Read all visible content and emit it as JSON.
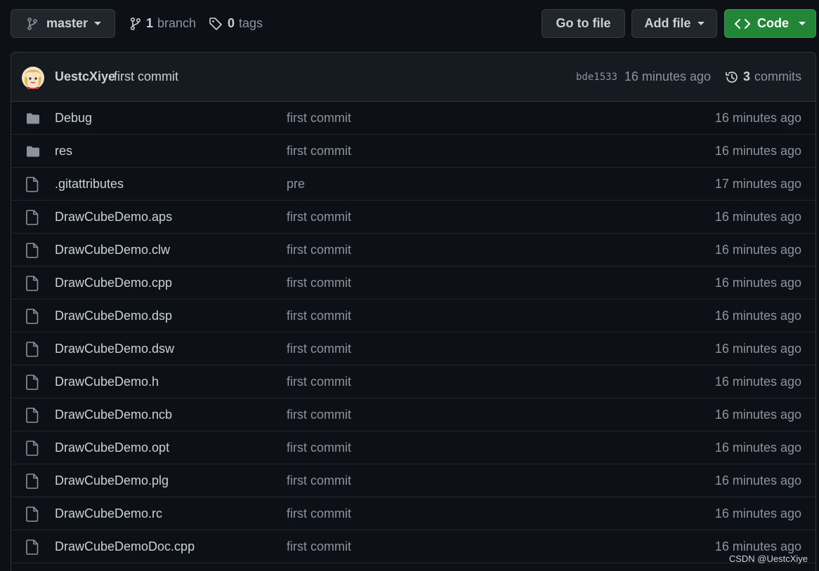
{
  "toolbar": {
    "branch_name": "master",
    "branches_count": "1",
    "branches_label": "branch",
    "tags_count": "0",
    "tags_label": "tags",
    "goto_file_label": "Go to file",
    "add_file_label": "Add file",
    "code_label": "Code"
  },
  "latest_commit": {
    "author": "UestcXiye",
    "message": "first commit",
    "sha": "bde1533",
    "age": "16 minutes ago",
    "commits_count": "3",
    "commits_label": "commits"
  },
  "files": [
    {
      "type": "folder",
      "name": "Debug",
      "commit": "first commit",
      "age": "16 minutes ago"
    },
    {
      "type": "folder",
      "name": "res",
      "commit": "first commit",
      "age": "16 minutes ago"
    },
    {
      "type": "file",
      "name": ".gitattributes",
      "commit": "pre",
      "age": "17 minutes ago"
    },
    {
      "type": "file",
      "name": "DrawCubeDemo.aps",
      "commit": "first commit",
      "age": "16 minutes ago"
    },
    {
      "type": "file",
      "name": "DrawCubeDemo.clw",
      "commit": "first commit",
      "age": "16 minutes ago"
    },
    {
      "type": "file",
      "name": "DrawCubeDemo.cpp",
      "commit": "first commit",
      "age": "16 minutes ago"
    },
    {
      "type": "file",
      "name": "DrawCubeDemo.dsp",
      "commit": "first commit",
      "age": "16 minutes ago"
    },
    {
      "type": "file",
      "name": "DrawCubeDemo.dsw",
      "commit": "first commit",
      "age": "16 minutes ago"
    },
    {
      "type": "file",
      "name": "DrawCubeDemo.h",
      "commit": "first commit",
      "age": "16 minutes ago"
    },
    {
      "type": "file",
      "name": "DrawCubeDemo.ncb",
      "commit": "first commit",
      "age": "16 minutes ago"
    },
    {
      "type": "file",
      "name": "DrawCubeDemo.opt",
      "commit": "first commit",
      "age": "16 minutes ago"
    },
    {
      "type": "file",
      "name": "DrawCubeDemo.plg",
      "commit": "first commit",
      "age": "16 minutes ago"
    },
    {
      "type": "file",
      "name": "DrawCubeDemo.rc",
      "commit": "first commit",
      "age": "16 minutes ago"
    },
    {
      "type": "file",
      "name": "DrawCubeDemoDoc.cpp",
      "commit": "first commit",
      "age": "16 minutes ago"
    }
  ],
  "watermark": "CSDN @UestcXiye",
  "colors": {
    "background": "#0d1117",
    "header_background": "#161b22",
    "code_button": "#238636",
    "muted_text": "#8b949e",
    "primary_text": "#c9d1d9"
  }
}
